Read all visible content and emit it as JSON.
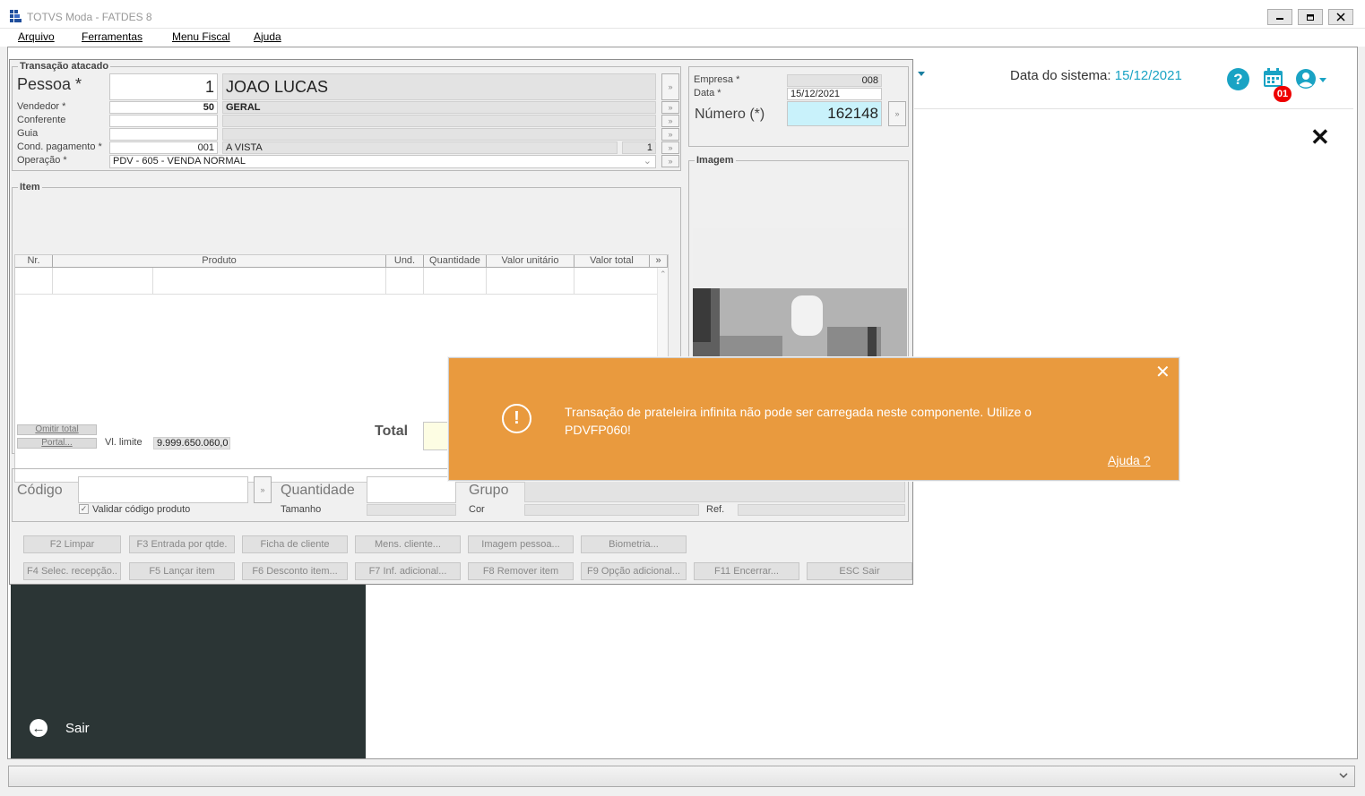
{
  "window": {
    "title": "TOTVS Moda - FATDES 8",
    "menu": [
      "Arquivo",
      "Ferramentas",
      "Menu Fiscal",
      "Ajuda"
    ]
  },
  "web": {
    "sysdate_label": "Data do sistema:",
    "sysdate_value": "15/12/2021",
    "calendar_badge": "01",
    "help_glyph": "?",
    "sair_label": "Sair"
  },
  "form": {
    "transacao_title": "Transação atacado",
    "pessoa": {
      "label": "Pessoa *",
      "code": "1",
      "name": "JOAO LUCAS"
    },
    "vendedor": {
      "label": "Vendedor *",
      "code": "50",
      "name": "GERAL"
    },
    "conferente": {
      "label": "Conferente"
    },
    "guia": {
      "label": "Guia"
    },
    "cond_pagamento": {
      "label": "Cond. pagamento *",
      "code": "001",
      "name": "A VISTA",
      "parcelas": "1"
    },
    "operacao": {
      "label": "Operação *",
      "value": "PDV - 605 - VENDA NORMAL"
    },
    "empresa": {
      "label": "Empresa *",
      "value": "008"
    },
    "data": {
      "label": "Data *",
      "value": "15/12/2021"
    },
    "numero": {
      "label": "Número (*)",
      "value": "162148"
    },
    "imagem_title": "Imagem",
    "item_title": "Item",
    "columns": [
      "Nr.",
      "Produto",
      "Und.",
      "Quantidade",
      "Valor unitário",
      "Valor total"
    ],
    "omitir_total": "Omitir total",
    "portal": "Portal...",
    "vl_limite_label": "Vl. limite",
    "vl_limite_value": "9.999.650.060,0",
    "total_label": "Total",
    "codigo_label": "Código",
    "validar_codigo": "Validar código produto",
    "quantidade_label": "Quantidade",
    "tamanho_label": "Tamanho",
    "grupo_label": "Grupo",
    "cor_label": "Cor",
    "ref_label": "Ref."
  },
  "buttons_row1": [
    "F2 Limpar",
    "F3 Entrada por qtde.",
    "Ficha de cliente",
    "Mens. cliente...",
    "Imagem pessoa...",
    "Biometria..."
  ],
  "buttons_row2": [
    "F4 Selec. recepção..",
    "F5 Lançar item",
    "F6 Desconto item...",
    "F7 Inf. adicional...",
    "F8 Remover item",
    "F9 Opção adicional...",
    "F11 Encerrar...",
    "ESC Sair"
  ],
  "toast": {
    "message": "Transação de prateleira infinita não pode ser carregada neste componente. Utilize o PDVFP060!",
    "help_link": "Ajuda ?",
    "bg_color": "#e99a3e"
  }
}
